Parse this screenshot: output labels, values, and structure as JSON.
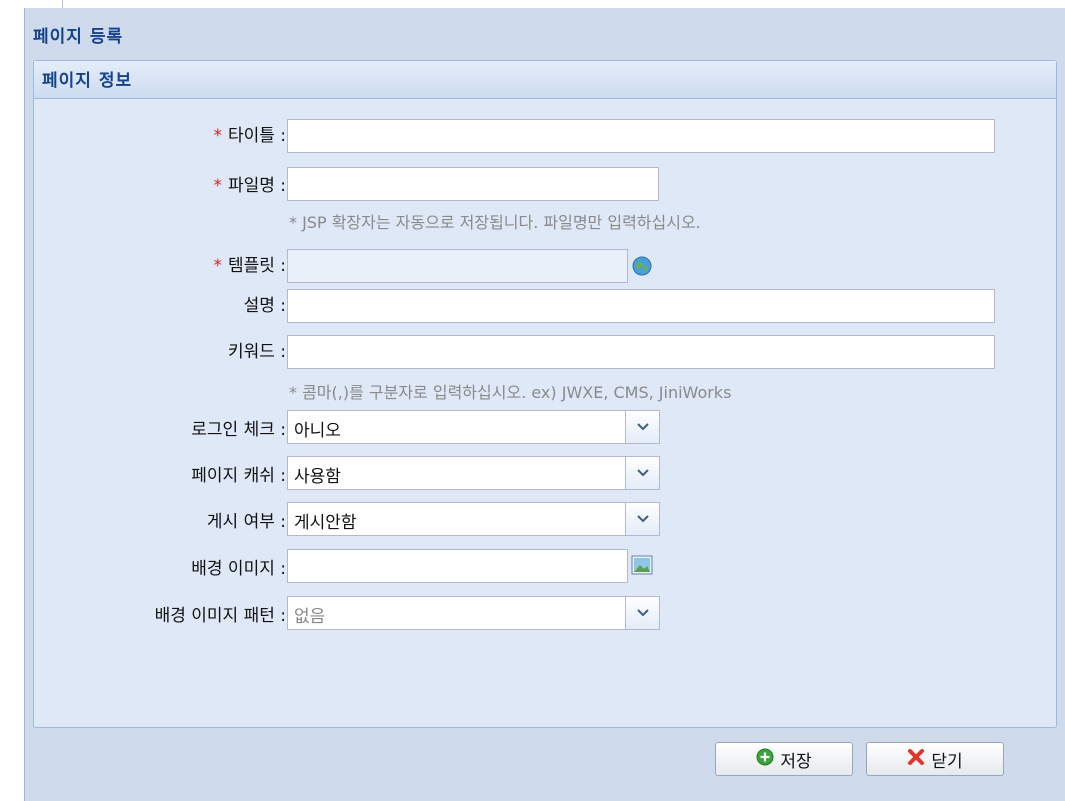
{
  "window": {
    "title": "페이지 등록"
  },
  "fieldset": {
    "title": "페이지 정보"
  },
  "form": {
    "required_mark": "*",
    "title": {
      "label": "타이틀 :",
      "value": ""
    },
    "filename": {
      "label": "파일명 :",
      "value": "",
      "hint": "* JSP 확장자는 자동으로 저장됩니다. 파일명만 입력하십시오."
    },
    "template": {
      "label": "템플릿 :",
      "value": ""
    },
    "description": {
      "label": "설명 :",
      "value": ""
    },
    "keywords": {
      "label": "키워드 :",
      "value": "",
      "hint": "* 콤마(,)를 구분자로 입력하십시오. ex) JWXE, CMS, JiniWorks"
    },
    "login_check": {
      "label": "로그인 체크 :",
      "selected": "아니오"
    },
    "page_cache": {
      "label": "페이지 캐쉬 :",
      "selected": "사용함"
    },
    "publish": {
      "label": "게시 여부 :",
      "selected": "게시안함"
    },
    "bg_image": {
      "label": "배경 이미지 :",
      "value": ""
    },
    "bg_pattern": {
      "label": "배경 이미지 패턴 :",
      "selected": "없음"
    }
  },
  "buttons": {
    "save": "저장",
    "close": "닫기"
  },
  "colors": {
    "title_text": "#15428b",
    "panel_bg": "#dfe8f6",
    "window_bg": "#cfdbec",
    "border": "#99bbe8",
    "required": "#e02020",
    "hint": "#8a8a8a"
  },
  "icons": {
    "template_picker": "globe-icon",
    "image_picker": "image-icon",
    "dropdown": "chevron-down-icon",
    "save": "plus-circle-icon",
    "close": "close-x-icon"
  }
}
